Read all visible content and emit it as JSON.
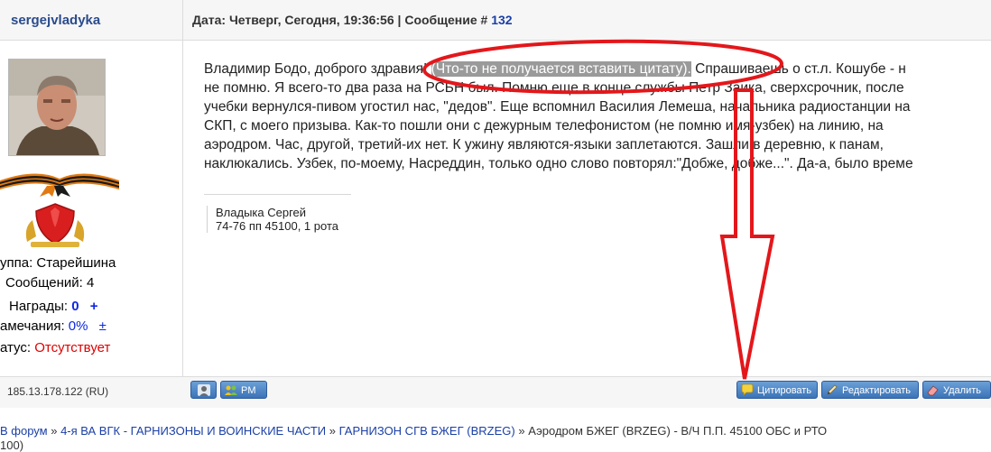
{
  "post": {
    "username": "sergejvladyka",
    "date_label": "Дата: Четверг, Сегодня, 19:36:56 | Сообщение # ",
    "message_number": "132"
  },
  "user_info": {
    "group": "уппа: Старейшина",
    "messages": "Сообщений: 4",
    "awards_label": "Награды:",
    "awards_value": "0",
    "awards_plus": "+",
    "remarks_label": "амечания:",
    "remarks_value": "0%",
    "remarks_pm": "±",
    "status_label": "атус:",
    "status_value": "Отсутствует"
  },
  "message": {
    "l1_a": "Владимир Бодо, доброго здравия! ",
    "l1_hl": "(Что-то не получается вставить цитату).",
    "l1_b": " Спрашиваешь о ст.л. Кошубе - н",
    "l2": "не помню. Я всего-то два раза на РСБН был. Помню еще в конце службы Петр Заика, сверхсрочник, после",
    "l3": "учебки вернулся-пивом угостил нас, \"дедов\". Еще вспомнил Василия Лемеша, начальника радиостанции на",
    "l4": "СКП, с моего призыва. Как-то пошли они с дежурным телефонистом (не помню имя-узбек) на линию, на",
    "l5": "аэродром. Час, другой, третий-их нет. К ужину являются-языки заплетаются. Зашли в деревню, к панам,",
    "l6": "наклюкались. Узбек, по-моему, Насреддин, только одно слово повторял:\"Добже, добже...\". Да-а, было времe"
  },
  "signature": {
    "name": "Владыка Сергей",
    "unit": "74-76 пп 45100, 1 рота"
  },
  "footer": {
    "ip": "185.13.178.122 (RU)",
    "pm_label": "PM",
    "quote_label": "Цитировать",
    "edit_label": "Редактировать",
    "delete_label": "Удалить"
  },
  "breadcrumb": {
    "item1": "В форум",
    "item2": "4-я ВА ВГК - ГАРНИЗОНЫ И ВОИНСКИЕ ЧАСТИ",
    "item3": "ГАРНИЗОН СГВ БЖЕГ (BRZEG)",
    "current": "Аэродром БЖЕГ (BRZEG) - В/Ч П.П. 45100 ОБС и РТО",
    "second_line": "100)",
    "sep": "»"
  },
  "colors": {
    "annotation": "#e3171b",
    "link": "#1a3fa6",
    "header_bg": "#f6f6f6"
  }
}
